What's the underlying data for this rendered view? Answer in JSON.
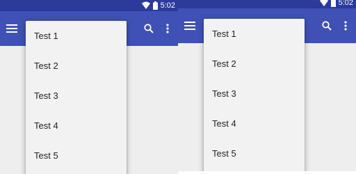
{
  "screens": [
    {
      "status_time": "5:02",
      "appbar": {
        "menu_icon": "hamburger-menu-icon",
        "search_icon": "search-icon",
        "overflow_icon": "more-vert-icon"
      },
      "dropdown": {
        "items": [
          "Test 1",
          "Test 2",
          "Test 3",
          "Test 4",
          "Test 5"
        ]
      }
    },
    {
      "status_time": "5:02",
      "appbar": {
        "menu_icon": "hamburger-menu-icon",
        "search_icon": "search-icon",
        "overflow_icon": "more-vert-icon"
      },
      "dropdown": {
        "items": [
          "Test 1",
          "Test 2",
          "Test 3",
          "Test 4",
          "Test 5"
        ]
      }
    }
  ],
  "colors": {
    "status_bar": "#2b3a9b",
    "app_bar": "#3f51b5",
    "background": "#eeeeee",
    "dropdown": "#f2f2f2"
  }
}
